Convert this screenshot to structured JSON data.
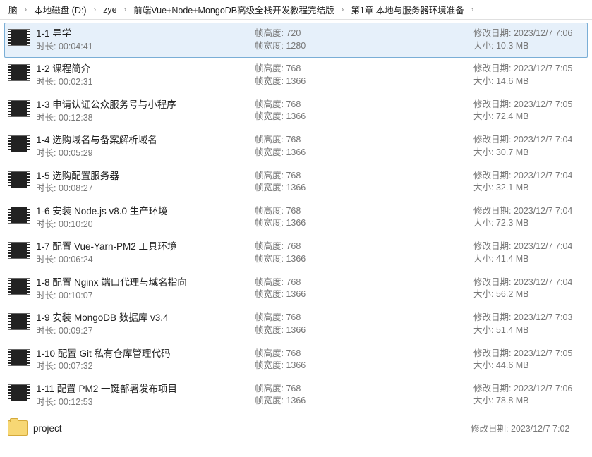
{
  "breadcrumb": [
    "脑",
    "本地磁盘 (D:)",
    "zye",
    "前端Vue+Node+MongoDB高级全栈开发教程完结版",
    "第1章 本地与服务器环境准备"
  ],
  "labels": {
    "duration": "时长:",
    "frameHeight": "帧高度:",
    "frameWidth": "帧宽度:",
    "modified": "修改日期:",
    "size": "大小:"
  },
  "files": [
    {
      "type": "video",
      "selected": true,
      "name": "1-1 导学",
      "duration": "00:04:41",
      "fh": "720",
      "fw": "1280",
      "modified": "2023/12/7 7:06",
      "size": "10.3 MB"
    },
    {
      "type": "video",
      "selected": false,
      "name": "1-2 课程简介",
      "duration": "00:02:31",
      "fh": "768",
      "fw": "1366",
      "modified": "2023/12/7 7:05",
      "size": "14.6 MB"
    },
    {
      "type": "video",
      "selected": false,
      "name": "1-3 申请认证公众服务号与小程序",
      "duration": "00:12:38",
      "fh": "768",
      "fw": "1366",
      "modified": "2023/12/7 7:05",
      "size": "72.4 MB"
    },
    {
      "type": "video",
      "selected": false,
      "name": "1-4 选购域名与备案解析域名",
      "duration": "00:05:29",
      "fh": "768",
      "fw": "1366",
      "modified": "2023/12/7 7:04",
      "size": "30.7 MB"
    },
    {
      "type": "video",
      "selected": false,
      "name": "1-5 选购配置服务器",
      "duration": "00:08:27",
      "fh": "768",
      "fw": "1366",
      "modified": "2023/12/7 7:04",
      "size": "32.1 MB"
    },
    {
      "type": "video",
      "selected": false,
      "name": "1-6 安装 Node.js v8.0 生产环境",
      "duration": "00:10:20",
      "fh": "768",
      "fw": "1366",
      "modified": "2023/12/7 7:04",
      "size": "72.3 MB"
    },
    {
      "type": "video",
      "selected": false,
      "name": "1-7 配置 Vue-Yarn-PM2 工具环境",
      "duration": "00:06:24",
      "fh": "768",
      "fw": "1366",
      "modified": "2023/12/7 7:04",
      "size": "41.4 MB"
    },
    {
      "type": "video",
      "selected": false,
      "name": "1-8 配置 Nginx 端口代理与域名指向",
      "duration": "00:10:07",
      "fh": "768",
      "fw": "1366",
      "modified": "2023/12/7 7:04",
      "size": "56.2 MB"
    },
    {
      "type": "video",
      "selected": false,
      "name": "1-9 安装 MongoDB 数据库 v3.4",
      "duration": "00:09:27",
      "fh": "768",
      "fw": "1366",
      "modified": "2023/12/7 7:03",
      "size": "51.4 MB"
    },
    {
      "type": "video",
      "selected": false,
      "name": "1-10 配置 Git 私有仓库管理代码",
      "duration": "00:07:32",
      "fh": "768",
      "fw": "1366",
      "modified": "2023/12/7 7:05",
      "size": "44.6 MB"
    },
    {
      "type": "video",
      "selected": false,
      "name": "1-11 配置 PM2 一键部署发布项目",
      "duration": "00:12:53",
      "fh": "768",
      "fw": "1366",
      "modified": "2023/12/7 7:06",
      "size": "78.8 MB"
    },
    {
      "type": "folder",
      "selected": false,
      "name": "project",
      "modified": "2023/12/7 7:02"
    }
  ]
}
